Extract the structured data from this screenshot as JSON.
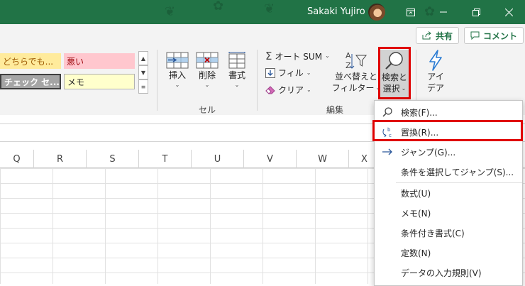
{
  "titlebar": {
    "user_name": "Sakaki Yujiro",
    "bg_color": "#217346"
  },
  "header_actions": {
    "share_label": "共有",
    "comment_label": "コメント"
  },
  "styles_gallery": {
    "cells": [
      {
        "label": "どちらでも..."
      },
      {
        "label": "悪い"
      },
      {
        "label": "チェック セ..."
      },
      {
        "label": "メモ"
      }
    ]
  },
  "cells_group": {
    "insert_label": "挿入",
    "delete_label": "削除",
    "format_label": "書式",
    "group_label": "セル"
  },
  "editing_group": {
    "autosum_label": "オート SUM",
    "fill_label": "フィル",
    "clear_label": "クリア",
    "sort_filter_line1": "並べ替えと",
    "sort_filter_line2": "フィルター",
    "find_select_line1": "検索と",
    "find_select_line2": "選択",
    "group_label": "編集"
  },
  "ideas": {
    "line1": "アイ",
    "line2": "デア"
  },
  "columns": [
    "Q",
    "R",
    "S",
    "T",
    "U",
    "V",
    "W",
    "X"
  ],
  "menu": {
    "items": [
      {
        "label": "検索(F)...",
        "icon": "search-icon"
      },
      {
        "label": "置換(R)...",
        "icon": "replace-icon",
        "highlighted": true
      },
      {
        "label": "ジャンプ(G)...",
        "icon": "arrow-right-icon"
      },
      {
        "label": "条件を選択してジャンプ(S)...",
        "icon": ""
      },
      {
        "label": "数式(U)",
        "icon": ""
      },
      {
        "label": "メモ(N)",
        "icon": ""
      },
      {
        "label": "条件付き書式(C)",
        "icon": ""
      },
      {
        "label": "定数(N)",
        "icon": ""
      },
      {
        "label": "データの入力規則(V)",
        "icon": ""
      }
    ]
  },
  "accent_red": "#e00000"
}
